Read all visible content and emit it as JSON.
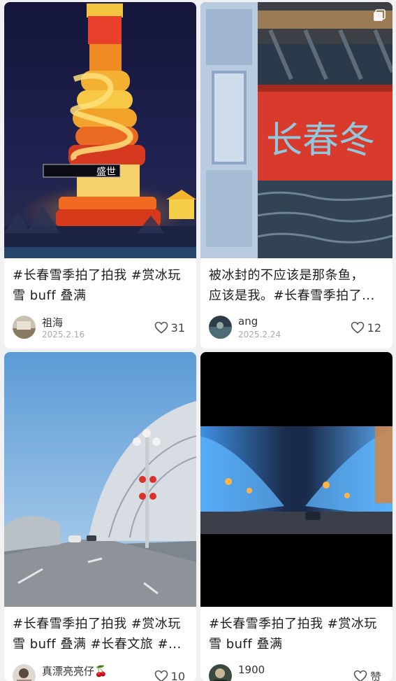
{
  "feed": {
    "cards": [
      {
        "title_line1": "#长春雪季拍了拍我 #赏冰玩",
        "title_line2": "雪 buff 叠满",
        "author": "祖海",
        "date": "2025.2.16",
        "likes": "31",
        "cover_sign_text": "盛世"
      },
      {
        "title_line1": "被冰封的不应该是那条鱼，",
        "title_line2": "应该是我。#长春雪季拍了...",
        "author": "ang",
        "date": "2025.2.24",
        "likes": "12",
        "cover_sign_text": "长春冬"
      },
      {
        "title_line1": "#长春雪季拍了拍我 #赏冰玩",
        "title_line2": "雪 buff 叠满 #长春文旅 #...",
        "author": "真漂亮亮仔🍒",
        "date": "",
        "likes": "10"
      },
      {
        "title_line1": "#长春雪季拍了拍我 #赏冰玩",
        "title_line2": "雪 buff 叠满",
        "author": "1900",
        "date": "",
        "likes": "赞"
      }
    ]
  },
  "icons": {
    "like": "heart-outline-icon",
    "multi_image": "multi-image-icon"
  },
  "colors": {
    "background": "#f1f1f3",
    "card": "#ffffff",
    "date_text": "#aaaaaa"
  }
}
